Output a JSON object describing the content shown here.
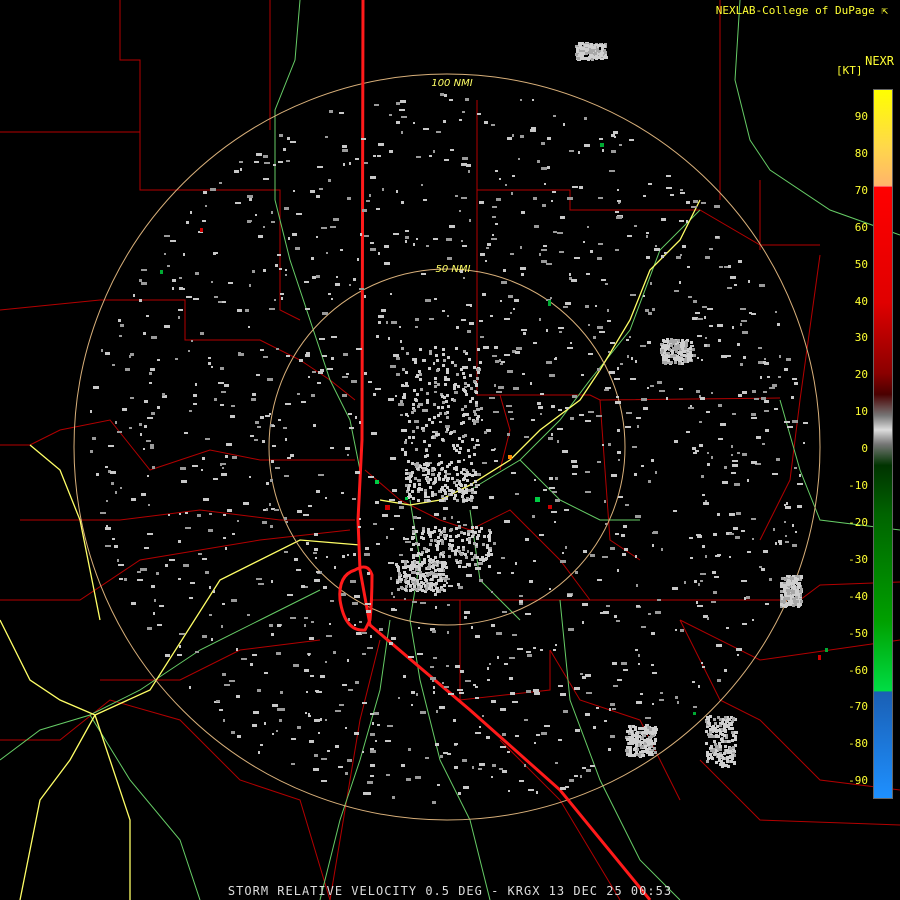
{
  "header": {
    "source": "NEXLAB-College of DuPage",
    "logo_icon": "nexlab-logo-icon",
    "product": "NEXR",
    "unit": "[KT]"
  },
  "footer": {
    "caption": "STORM RELATIVE VELOCITY 0.5 DEG - KRGX 13 DEC 25 00:53"
  },
  "range_rings": {
    "inner_label": "50 NMI",
    "outer_label": "100 NMI",
    "color": "#d9b07a"
  },
  "legend": {
    "ticks": [
      "90",
      "80",
      "70",
      "60",
      "50",
      "40",
      "30",
      "20",
      "10",
      "0",
      "-10",
      "-20",
      "-30",
      "-40",
      "-50",
      "-60",
      "-70",
      "-80",
      "-90"
    ],
    "colors": {
      "top": "#ffff00",
      "high": "#ff0000",
      "mid": "#8b0000",
      "zero": "#bbbbbb",
      "neg_low": "#006400",
      "neg_high": "#00dd44",
      "bottom": "#1e90ff"
    }
  },
  "map_colors": {
    "background": "#000000",
    "county_lines": "#b30000",
    "highways": "#ffff66",
    "roads": "#66cc66",
    "interstate": "#ff1a1a",
    "echo_gray": "#c8c8c8"
  }
}
